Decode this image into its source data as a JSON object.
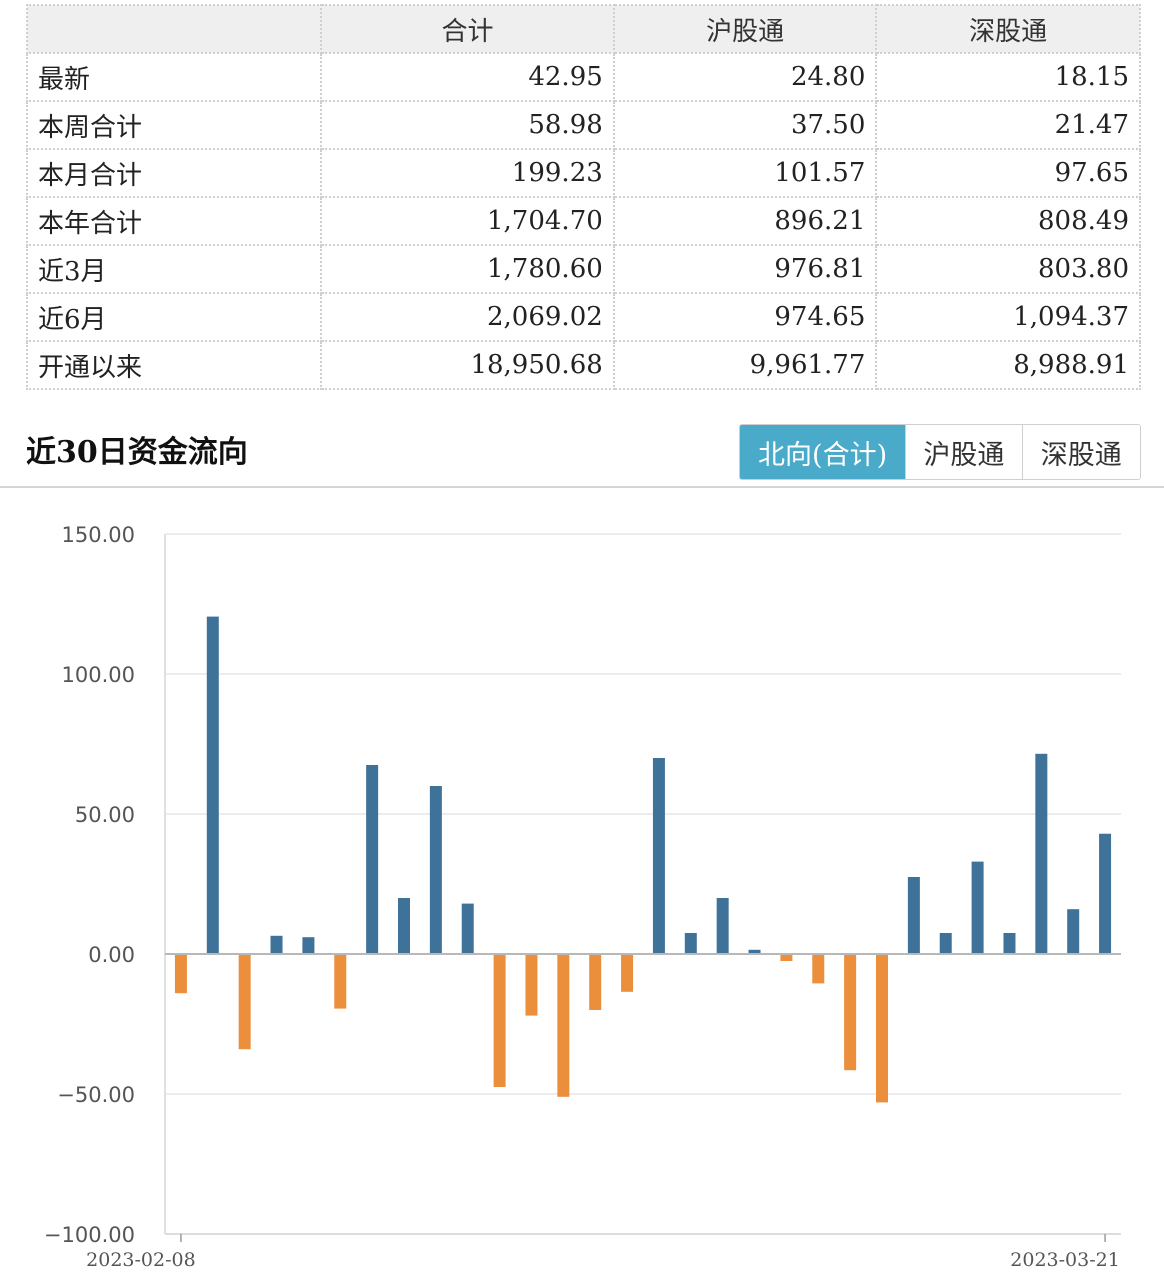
{
  "table": {
    "headers": [
      "",
      "合计",
      "沪股通",
      "深股通"
    ],
    "rows": [
      {
        "label": "最新",
        "total": "42.95",
        "sh": "24.80",
        "sz": "18.15"
      },
      {
        "label": "本周合计",
        "total": "58.98",
        "sh": "37.50",
        "sz": "21.47"
      },
      {
        "label": "本月合计",
        "total": "199.23",
        "sh": "101.57",
        "sz": "97.65"
      },
      {
        "label": "本年合计",
        "total": "1,704.70",
        "sh": "896.21",
        "sz": "808.49"
      },
      {
        "label": "近3月",
        "total": "1,780.60",
        "sh": "976.81",
        "sz": "803.80"
      },
      {
        "label": "近6月",
        "total": "2,069.02",
        "sh": "974.65",
        "sz": "1,094.37"
      },
      {
        "label": "开通以来",
        "total": "18,950.68",
        "sh": "9,961.77",
        "sz": "8,988.91"
      }
    ]
  },
  "section": {
    "title": "近30日资金流向",
    "tabs": [
      {
        "label": "北向(合计)",
        "active": true
      },
      {
        "label": "沪股通",
        "active": false
      },
      {
        "label": "深股通",
        "active": false
      }
    ]
  },
  "colors": {
    "positive": "#3e7299",
    "negative": "#eb8f3c",
    "active_tab": "#4aaac9"
  },
  "chart_data": {
    "type": "bar",
    "title": "",
    "xlabel": "",
    "ylabel": "",
    "ylim": [
      -100,
      150
    ],
    "yticks": [
      -100,
      -50,
      0,
      50,
      100,
      150
    ],
    "ytick_labels": [
      "−100.00",
      "−50.00",
      "0.00",
      "50.00",
      "100.00",
      "150.00"
    ],
    "x_labels_shown": [
      "2023-02-08",
      "2023-03-21"
    ],
    "grid": true,
    "values": [
      -14,
      120.5,
      -34,
      6.5,
      6,
      -19.5,
      67.5,
      20,
      60,
      18,
      -47.5,
      -22,
      -51,
      -20,
      -13.5,
      70,
      7.5,
      20,
      1.5,
      -2.5,
      -10.5,
      -41.5,
      -53,
      27.5,
      7.5,
      33,
      7.5,
      71.5,
      16,
      42.95
    ]
  }
}
